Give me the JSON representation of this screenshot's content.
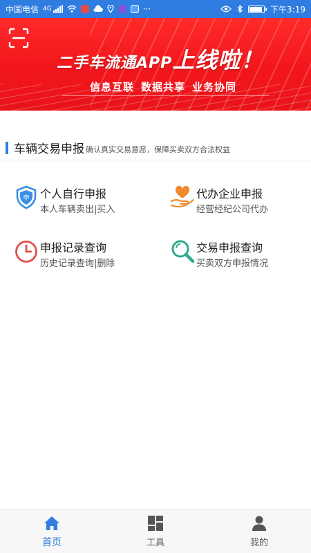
{
  "status_bar": {
    "carrier": "中国电信",
    "network": "4G",
    "dots": "···",
    "time": "下午3:19",
    "battery_level": 0.95
  },
  "banner": {
    "title_prefix": "二手车流通APP",
    "title_suffix": "上线啦！",
    "slogans": [
      "信息互联",
      "数据共享",
      "业务协同"
    ],
    "colors": {
      "background": "#f2161c",
      "text": "#ffffff"
    }
  },
  "section": {
    "title": "车辆交易申报",
    "subtitle": "确认真实交易意愿，保障买卖双方合法权益",
    "accent": "#2f7de0"
  },
  "menu": [
    {
      "title": "个人自行申报",
      "desc": "本人车辆卖出|买入",
      "icon": "shield-badge-icon",
      "color": "#3a8ee6"
    },
    {
      "title": "代办企业申报",
      "desc": "经营经纪公司代办",
      "icon": "heart-hand-icon",
      "color": "#f08a2c"
    },
    {
      "title": "申报记录查询",
      "desc": "历史记录查询|删除",
      "icon": "clock-icon",
      "color": "#e0504a"
    },
    {
      "title": "交易申报查询",
      "desc": "买卖双方申报情况",
      "icon": "magnifier-icon",
      "color": "#2fa88f"
    }
  ],
  "tabbar": {
    "items": [
      {
        "label": "首页",
        "icon": "home-icon",
        "active": true
      },
      {
        "label": "工具",
        "icon": "grid-icon",
        "active": false
      },
      {
        "label": "我的",
        "icon": "person-icon",
        "active": false
      }
    ],
    "active_color": "#2f7de0"
  }
}
